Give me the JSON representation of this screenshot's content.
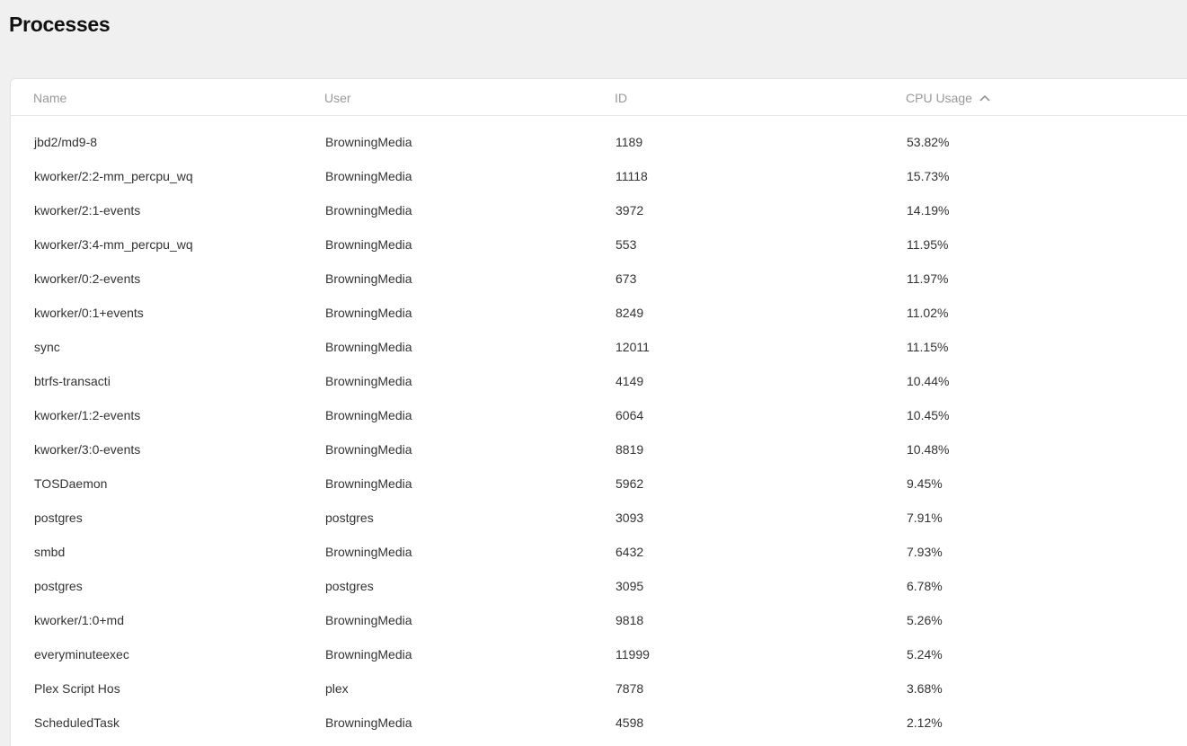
{
  "page": {
    "title": "Processes"
  },
  "table": {
    "columns": {
      "name": "Name",
      "user": "User",
      "id": "ID",
      "cpu": "CPU Usage"
    },
    "sort": {
      "column": "CPU Usage",
      "icon": "chevron-up-icon"
    },
    "rows": [
      {
        "name": "jbd2/md9-8",
        "user": "BrowningMedia",
        "id": "1189",
        "cpu": "53.82%"
      },
      {
        "name": "kworker/2:2-mm_percpu_wq",
        "user": "BrowningMedia",
        "id": "11118",
        "cpu": "15.73%"
      },
      {
        "name": "kworker/2:1-events",
        "user": "BrowningMedia",
        "id": "3972",
        "cpu": "14.19%"
      },
      {
        "name": "kworker/3:4-mm_percpu_wq",
        "user": "BrowningMedia",
        "id": "553",
        "cpu": "11.95%"
      },
      {
        "name": "kworker/0:2-events",
        "user": "BrowningMedia",
        "id": "673",
        "cpu": "11.97%"
      },
      {
        "name": "kworker/0:1+events",
        "user": "BrowningMedia",
        "id": "8249",
        "cpu": "11.02%"
      },
      {
        "name": "sync",
        "user": "BrowningMedia",
        "id": "12011",
        "cpu": "11.15%"
      },
      {
        "name": "btrfs-transacti",
        "user": "BrowningMedia",
        "id": "4149",
        "cpu": "10.44%"
      },
      {
        "name": "kworker/1:2-events",
        "user": "BrowningMedia",
        "id": "6064",
        "cpu": "10.45%"
      },
      {
        "name": "kworker/3:0-events",
        "user": "BrowningMedia",
        "id": "8819",
        "cpu": "10.48%"
      },
      {
        "name": "TOSDaemon",
        "user": "BrowningMedia",
        "id": "5962",
        "cpu": "9.45%"
      },
      {
        "name": "postgres",
        "user": "postgres",
        "id": "3093",
        "cpu": "7.91%"
      },
      {
        "name": "smbd",
        "user": "BrowningMedia",
        "id": "6432",
        "cpu": "7.93%"
      },
      {
        "name": "postgres",
        "user": "postgres",
        "id": "3095",
        "cpu": "6.78%"
      },
      {
        "name": "kworker/1:0+md",
        "user": "BrowningMedia",
        "id": "9818",
        "cpu": "5.26%"
      },
      {
        "name": "everyminuteexec",
        "user": "BrowningMedia",
        "id": "11999",
        "cpu": "5.24%"
      },
      {
        "name": "Plex Script Hos",
        "user": "plex",
        "id": "7878",
        "cpu": "3.68%"
      },
      {
        "name": "ScheduledTask",
        "user": "BrowningMedia",
        "id": "4598",
        "cpu": "2.12%"
      }
    ]
  }
}
